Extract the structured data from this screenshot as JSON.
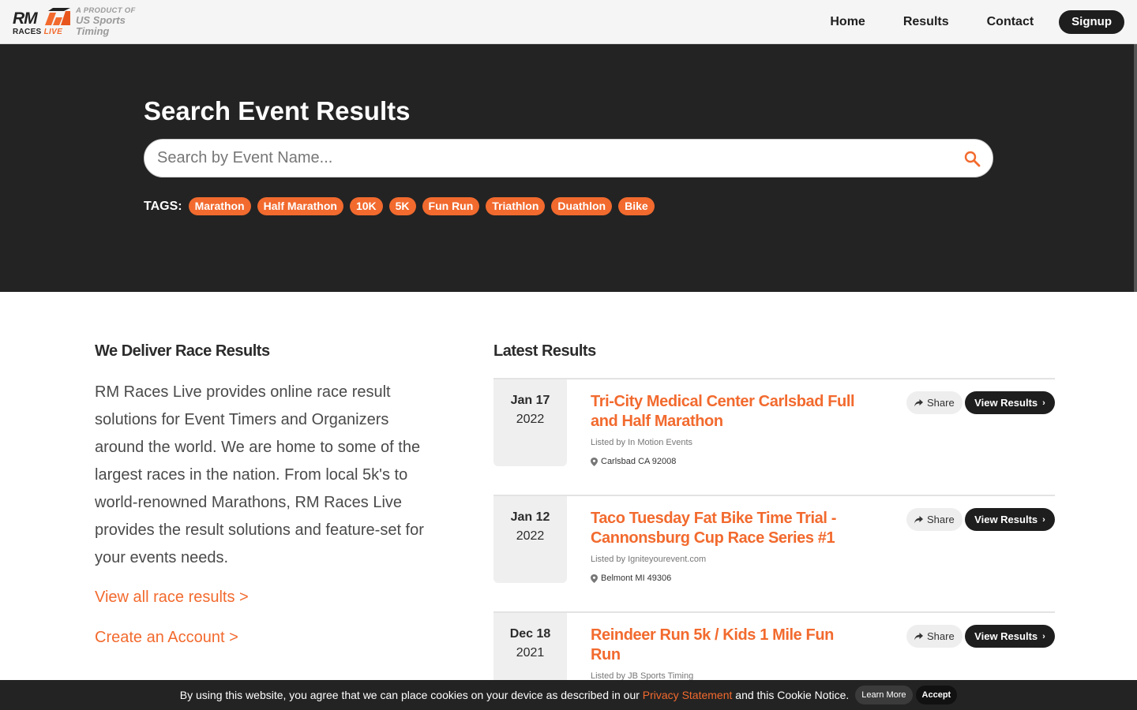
{
  "brand": {
    "logo_text": "RM",
    "logo_sub": "RACES",
    "logo_live": "LIVE",
    "product_line1": "A PRODUCT OF",
    "product_line2": "US Sports",
    "product_line3": "Timing",
    "accent_color": "#f26a2e"
  },
  "nav": {
    "home": "Home",
    "results": "Results",
    "contact": "Contact",
    "signup": "Signup"
  },
  "hero": {
    "title": "Search Event Results",
    "search_placeholder": "Search by Event Name...",
    "search_icon": "search-icon",
    "tags_label": "TAGS:",
    "tags": [
      "Marathon",
      "Half Marathon",
      "10K",
      "5K",
      "Fun Run",
      "Triathlon",
      "Duathlon",
      "Bike"
    ]
  },
  "about": {
    "title": "We Deliver Race Results",
    "text": "RM Races Live provides online race result solutions for Event Timers and Organizers around the world. We are home to some of the largest races in the nation. From local 5k's to world-renowned Marathons, RM Races Live provides the result solutions and feature-set for your events needs.",
    "link_all": "View all race results >",
    "link_account": "Create an Account >"
  },
  "latest": {
    "title": "Latest Results",
    "share_label": "Share",
    "view_label": "View Results",
    "items": [
      {
        "month_day": "Jan 17",
        "year": "2022",
        "title": "Tri-City Medical Center Carlsbad Full and Half Marathon",
        "listed_by": "Listed by In Motion Events",
        "location": "Carlsbad CA 92008"
      },
      {
        "month_day": "Jan 12",
        "year": "2022",
        "title": "Taco Tuesday Fat Bike Time Trial - Cannonsburg Cup Race Series #1",
        "listed_by": "Listed by Igniteyourevent.com",
        "location": "Belmont MI 49306"
      },
      {
        "month_day": "Dec 18",
        "year": "2021",
        "title": "Reindeer Run 5k / Kids 1 Mile Fun Run",
        "listed_by": "Listed by JB Sports Timing",
        "location": ""
      }
    ]
  },
  "cookie": {
    "text_before": "By using this website, you agree that we can place cookies on your device as described in our ",
    "privacy": "Privacy Statement",
    "text_after": " and this Cookie Notice.",
    "learn_more": "Learn More",
    "accept": "Accept"
  }
}
